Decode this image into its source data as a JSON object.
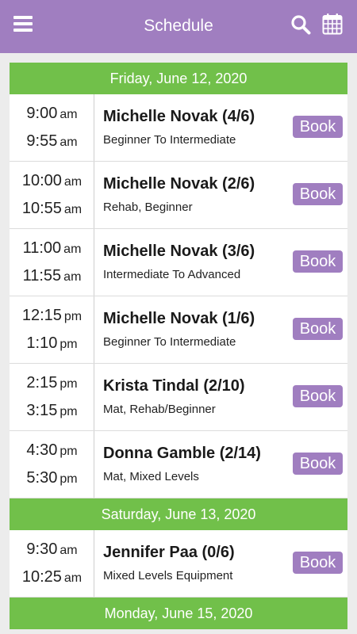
{
  "appbar": {
    "title": "Schedule",
    "menu_icon": "hamburger-menu-icon",
    "search_icon": "search-icon",
    "calendar_icon": "calendar-icon",
    "background": "#a07ec0"
  },
  "colors": {
    "day_header": "#71c04a",
    "book_button": "#a07ec0"
  },
  "days": [
    {
      "date": "Friday, June 12, 2020",
      "classes": [
        {
          "start": "9:00",
          "start_ampm": "am",
          "end": "9:55",
          "end_ampm": "am",
          "instructor": "Michelle Novak (4/6)",
          "level": "Beginner To Intermediate",
          "action": "Book"
        },
        {
          "start": "10:00",
          "start_ampm": "am",
          "end": "10:55",
          "end_ampm": "am",
          "instructor": "Michelle Novak (2/6)",
          "level": "Rehab, Beginner",
          "action": "Book"
        },
        {
          "start": "11:00",
          "start_ampm": "am",
          "end": "11:55",
          "end_ampm": "am",
          "instructor": "Michelle Novak (3/6)",
          "level": "Intermediate To Advanced",
          "action": "Book"
        },
        {
          "start": "12:15",
          "start_ampm": "pm",
          "end": "1:10",
          "end_ampm": "pm",
          "instructor": "Michelle Novak (1/6)",
          "level": "Beginner To Intermediate",
          "action": "Book"
        },
        {
          "start": "2:15",
          "start_ampm": "pm",
          "end": "3:15",
          "end_ampm": "pm",
          "instructor": "Krista Tindal (2/10)",
          "level": "Mat, Rehab/Beginner",
          "action": "Book"
        },
        {
          "start": "4:30",
          "start_ampm": "pm",
          "end": "5:30",
          "end_ampm": "pm",
          "instructor": "Donna Gamble (2/14)",
          "level": "Mat, Mixed Levels",
          "action": "Book"
        }
      ]
    },
    {
      "date": "Saturday, June 13, 2020",
      "classes": [
        {
          "start": "9:30",
          "start_ampm": "am",
          "end": "10:25",
          "end_ampm": "am",
          "instructor": "Jennifer Paa (0/6)",
          "level": "Mixed Levels Equipment",
          "action": "Book"
        }
      ]
    },
    {
      "date": "Monday, June 15, 2020",
      "classes": []
    }
  ]
}
